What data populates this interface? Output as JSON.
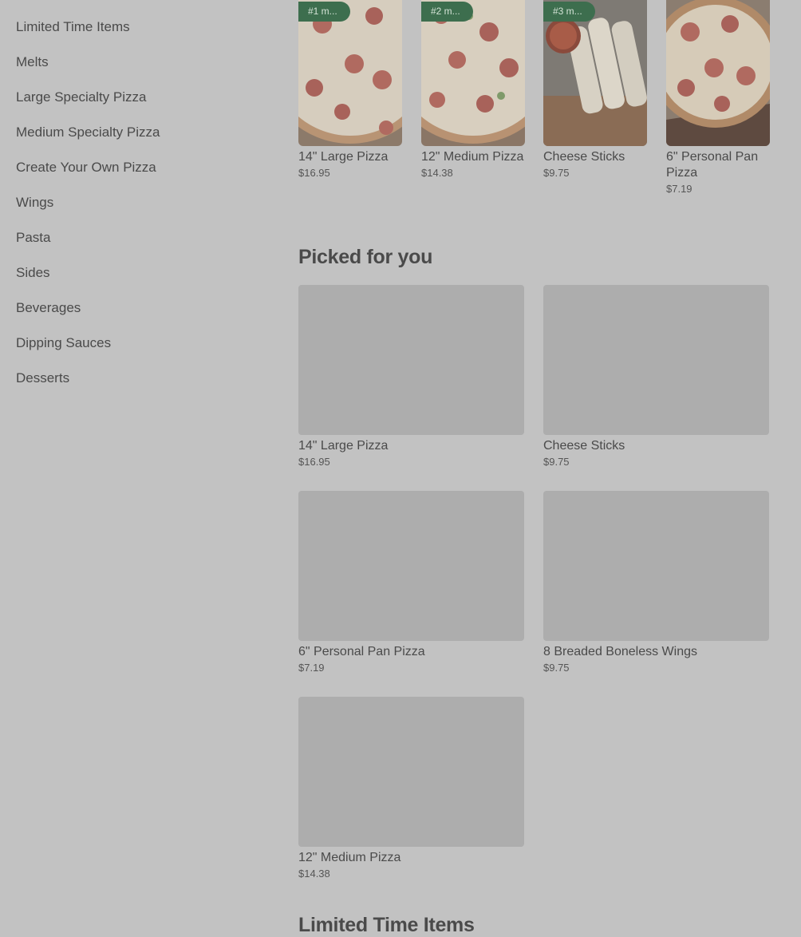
{
  "sidebar": {
    "items": [
      {
        "label": "Limited Time Items"
      },
      {
        "label": "Melts"
      },
      {
        "label": "Large Specialty Pizza"
      },
      {
        "label": "Medium Specialty Pizza"
      },
      {
        "label": "Create Your Own Pizza"
      },
      {
        "label": "Wings"
      },
      {
        "label": "Pasta"
      },
      {
        "label": "Sides"
      },
      {
        "label": "Beverages"
      },
      {
        "label": "Dipping Sauces"
      },
      {
        "label": "Desserts"
      }
    ]
  },
  "popular": {
    "items": [
      {
        "badge": "#1 m...",
        "name": "14\" Large Pizza",
        "price": "$16.95"
      },
      {
        "badge": "#2 m...",
        "name": "12\" Medium Pizza",
        "price": "$14.38"
      },
      {
        "badge": "#3 m...",
        "name": "Cheese Sticks",
        "price": "$9.75"
      },
      {
        "badge": "",
        "name": "6\" Personal Pan Pizza",
        "price": "$7.19"
      }
    ]
  },
  "picked": {
    "title": "Picked for you",
    "items": [
      {
        "name": "14\" Large Pizza",
        "price": "$16.95"
      },
      {
        "name": "Cheese Sticks",
        "price": "$9.75"
      },
      {
        "name": "6\" Personal Pan Pizza",
        "price": "$7.19"
      },
      {
        "name": "8 Breaded Boneless Wings",
        "price": "$9.75"
      },
      {
        "name": "12\" Medium Pizza",
        "price": "$14.38"
      }
    ]
  },
  "next_section": {
    "title": "Limited Time Items"
  },
  "colors": {
    "badge_green": "#3d6e4e",
    "overlay_gray": "#c2c2c2",
    "placeholder": "#adadad"
  }
}
